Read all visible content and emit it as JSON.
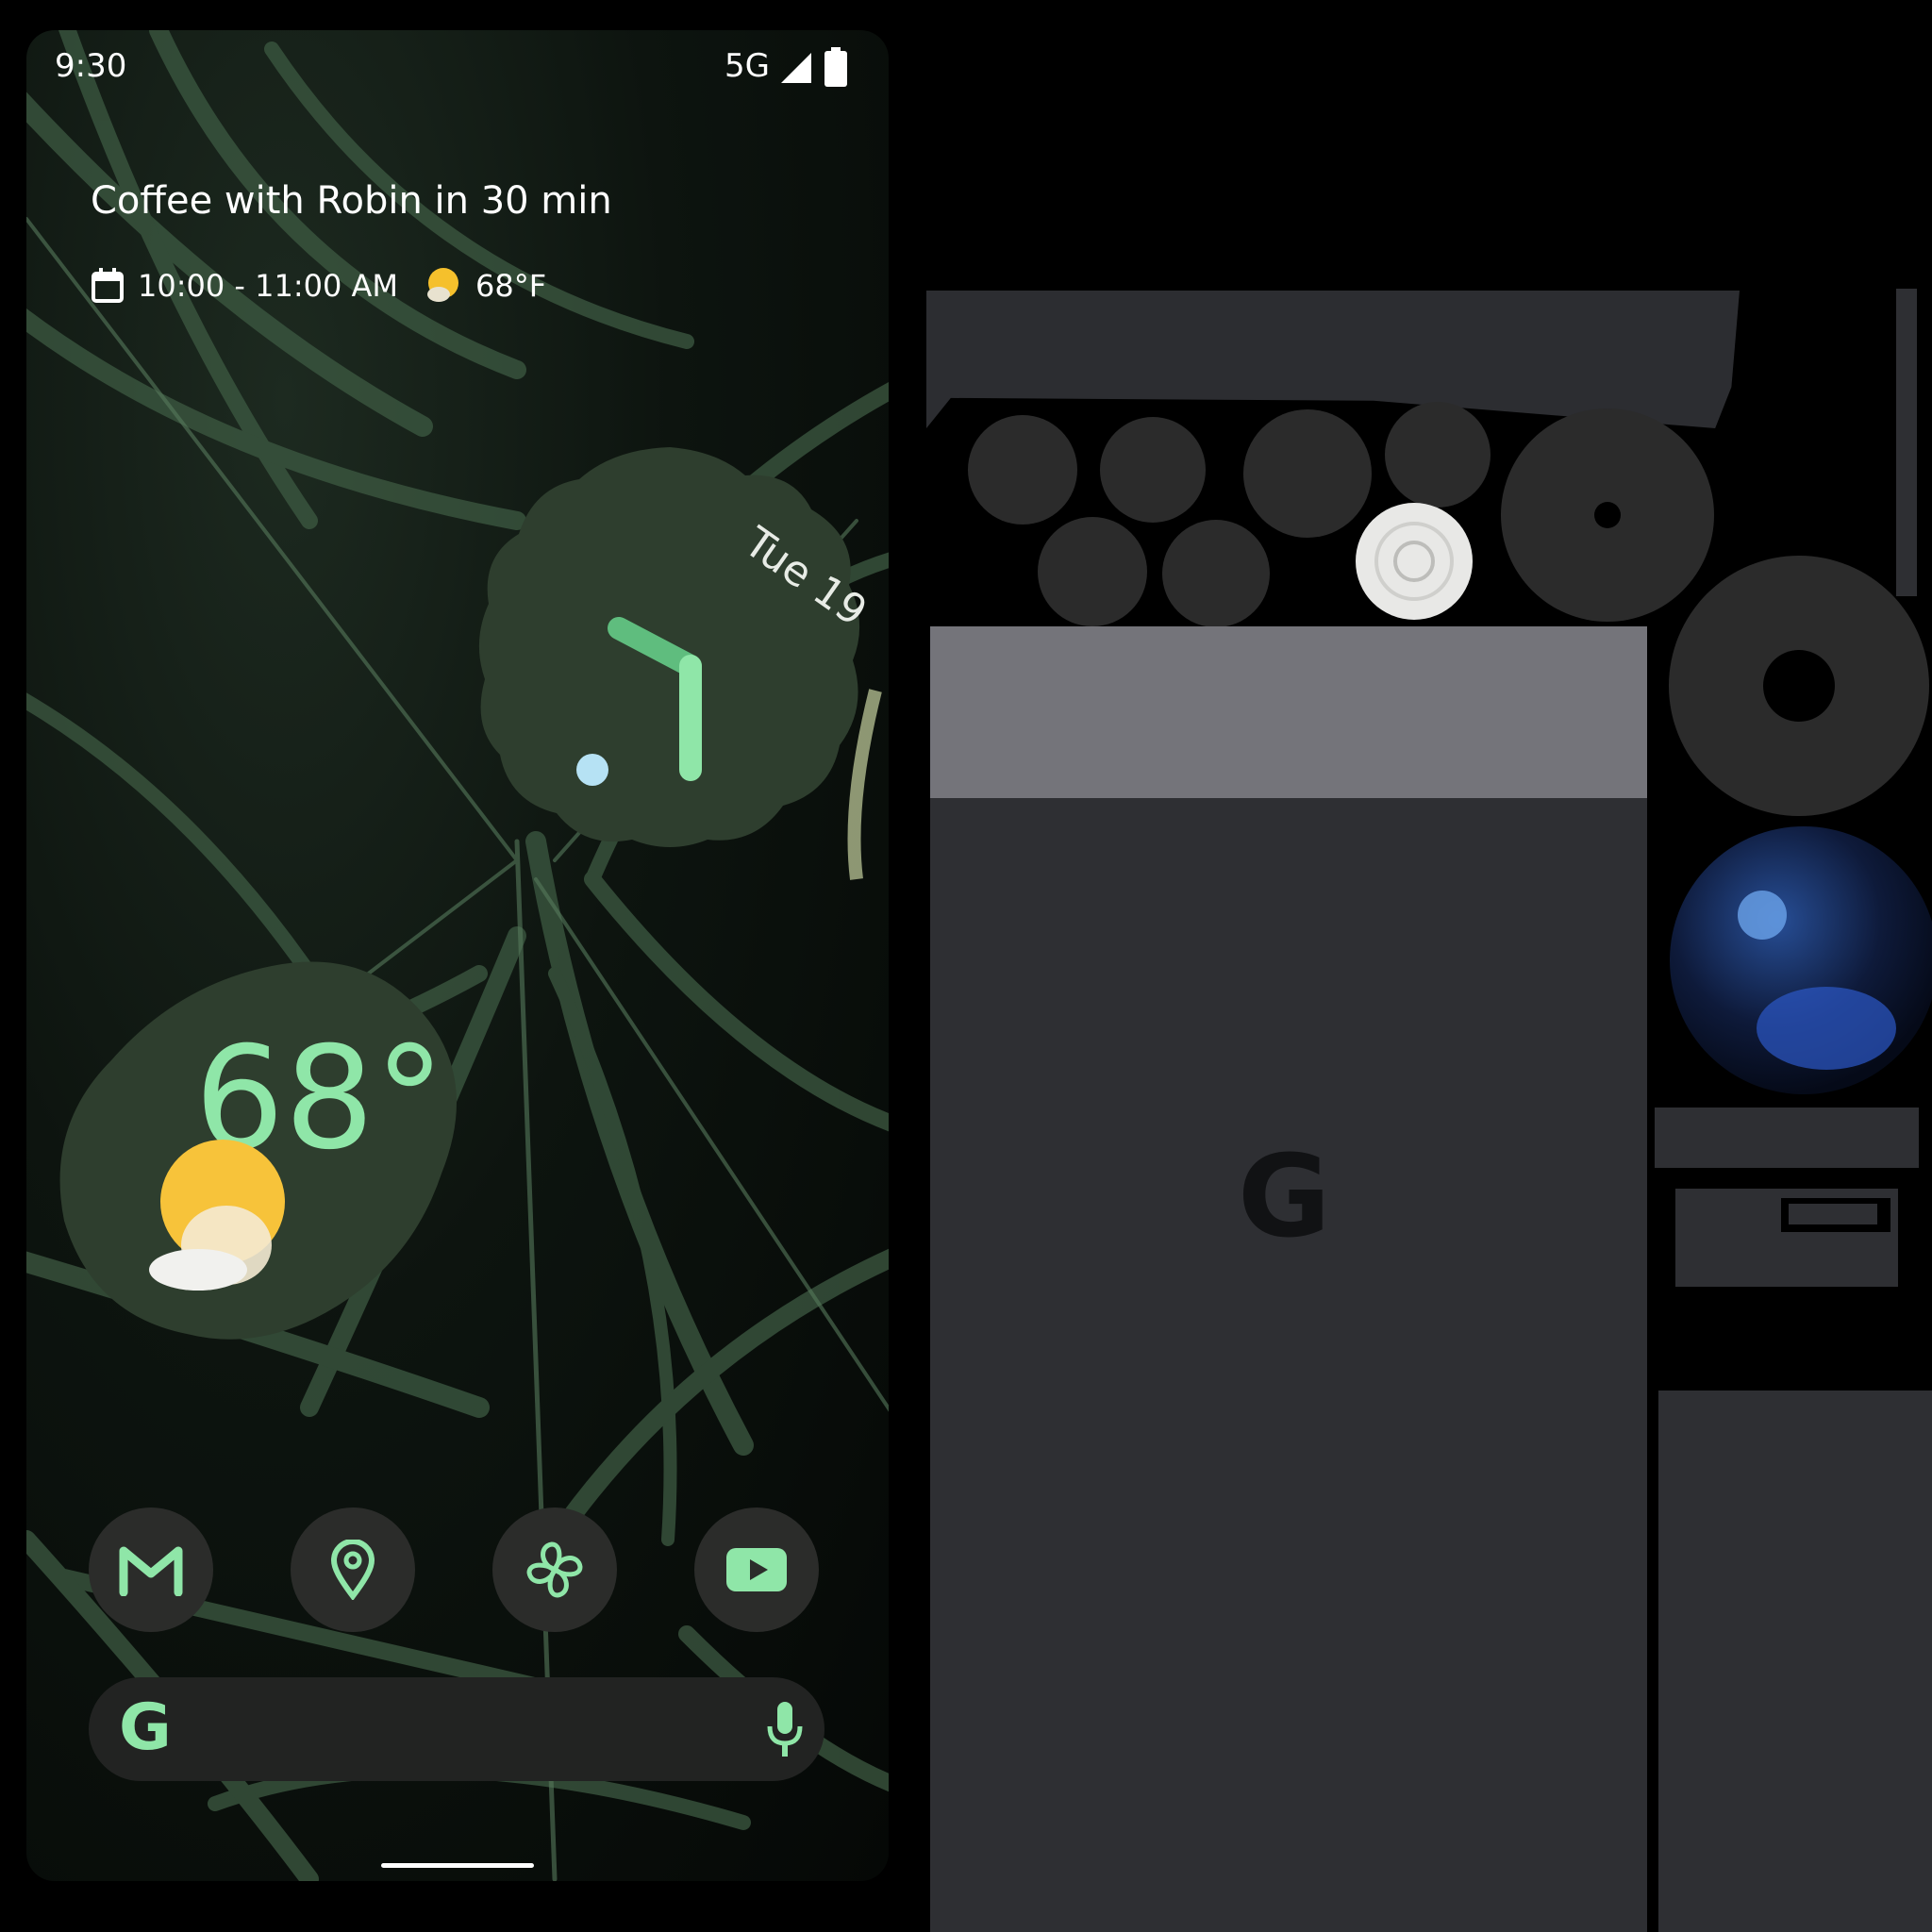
{
  "status_bar": {
    "time": "9:30",
    "network": "5G"
  },
  "at_a_glance": {
    "title": "Coffee with Robin in 30 min",
    "time_range": "10:00 - 11:00 AM",
    "temperature": "68°F"
  },
  "clock_widget": {
    "date": "Tue 19"
  },
  "weather_widget": {
    "temperature": "68°"
  },
  "dock": {
    "apps": [
      {
        "name": "gmail-icon"
      },
      {
        "name": "maps-icon"
      },
      {
        "name": "pinwheel-icon"
      },
      {
        "name": "youtube-icon"
      }
    ]
  },
  "search_bar": {
    "logo": "G"
  },
  "hardware_back": {
    "logo": "G"
  },
  "colors": {
    "accent_green": "#7fdca0",
    "widget_bg": "#2e3e2e",
    "dock_bg": "#2b2c2a",
    "device_gray": "#2e2f33"
  }
}
